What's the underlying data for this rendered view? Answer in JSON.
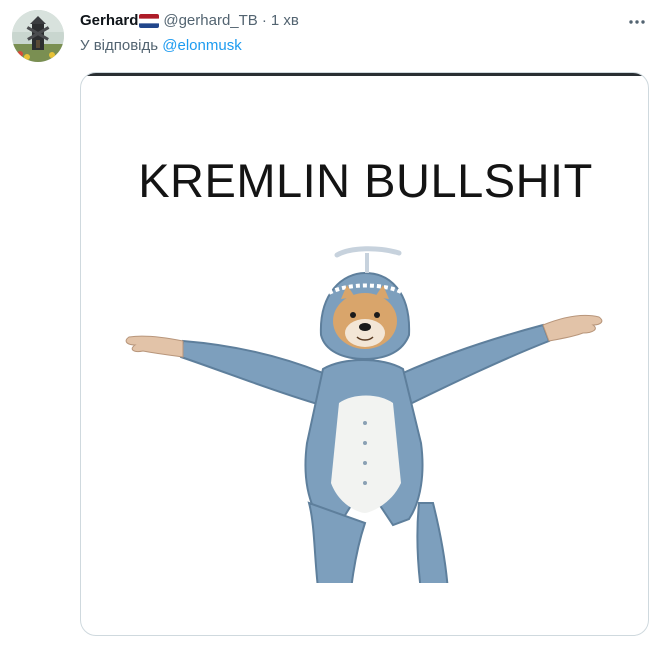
{
  "tweet": {
    "author_name": "Gerhard",
    "handle": "@gerhard_TB",
    "separator": "·",
    "time": "1 хв",
    "reply_prefix": "У відповідь",
    "reply_mention": "@elonmusk"
  },
  "media": {
    "caption": "KREMLIN BULLSHIT",
    "hood_text": "WANNABEE"
  },
  "icons": {
    "more": "more-horizontal-icon",
    "flag": "netherlands-flag-icon"
  },
  "colors": {
    "text": "#0f1419",
    "muted": "#536471",
    "link": "#1d9bf0",
    "border": "#cfd9de",
    "costume_blue": "#7d9fbd",
    "costume_belly": "#f2f3f1"
  }
}
